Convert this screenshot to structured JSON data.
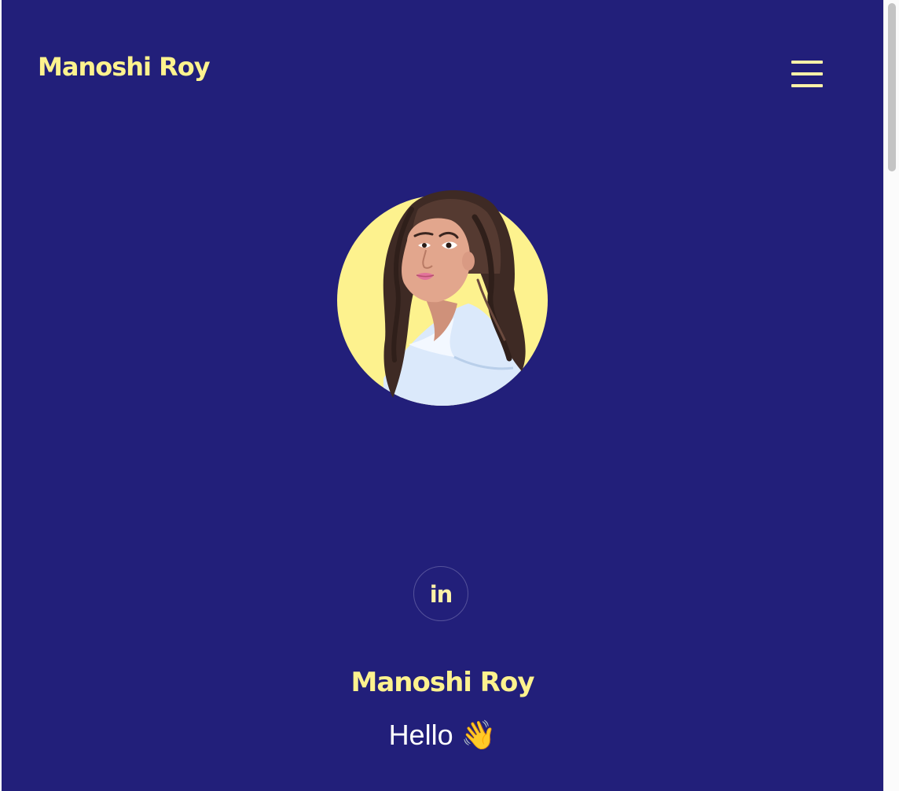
{
  "header": {
    "brand": "Manoshi Roy",
    "menu_icon": "hamburger-menu-icon"
  },
  "hero": {
    "avatar_icon": "woman-portrait-illustration",
    "social": {
      "linkedin_label": "in",
      "icon": "linkedin-icon"
    },
    "name": "Manoshi Roy",
    "greeting": "Hello 👋"
  },
  "colors": {
    "background": "#221f7a",
    "accent": "#fdf28e",
    "text": "#ffffff"
  }
}
